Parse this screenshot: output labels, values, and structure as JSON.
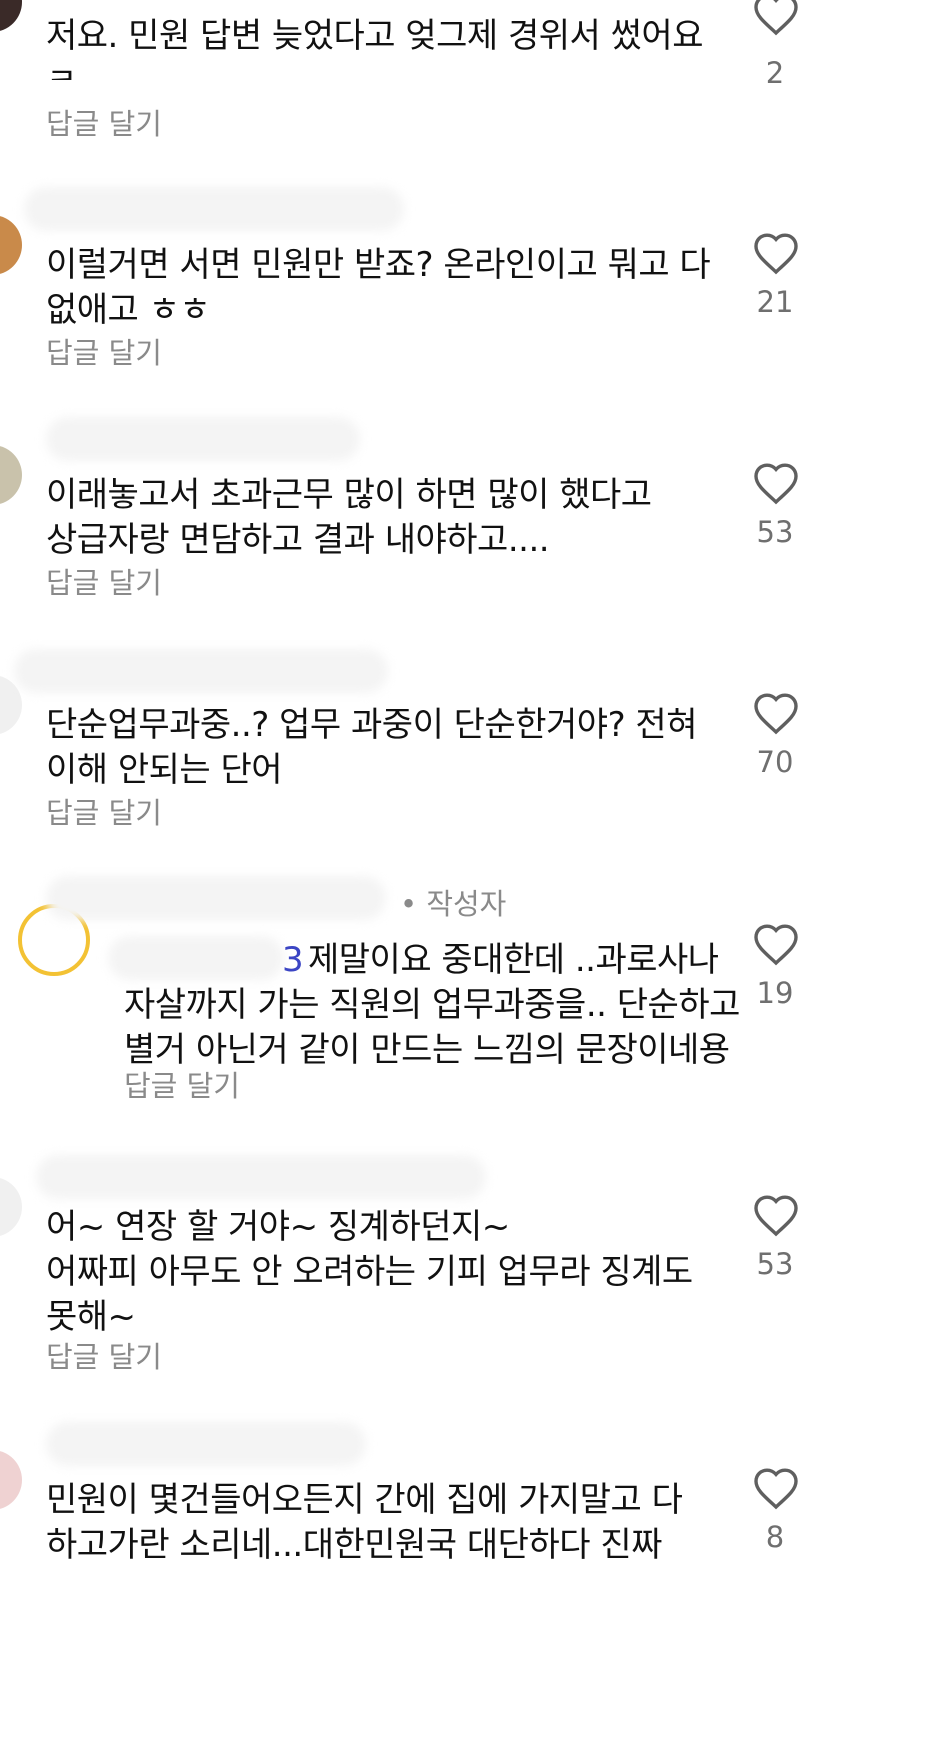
{
  "colors": {
    "text": "#111111",
    "secondary": "#8a8a8a",
    "count": "#6f6f6f",
    "mention": "#3b45c4"
  },
  "icons": {
    "like": "heart-outline-icon"
  },
  "comments": [
    {
      "text": "저요. 민원 답변 늦었다고 엊그제 경위서 썼어요ㅋ\nㅋㅋㅋㅋ",
      "reply_label": "답글 달기",
      "likes": "2"
    },
    {
      "text": "이럴거면 서면 민원만 받죠? 온라인이고 뭐고 다\n없애고 ㅎㅎ",
      "reply_label": "답글 달기",
      "likes": "21"
    },
    {
      "text": "이래놓고서 초과근무 많이 하면 많이 했다고\n상급자랑 면담하고 결과 내야하고....",
      "reply_label": "답글 달기",
      "likes": "53"
    },
    {
      "text": "단순업무과중..? 업무 과중이 단순한거야? 전혀\n이해 안되는 단어",
      "reply_label": "답글 달기",
      "likes": "70"
    },
    {
      "author_tag": "• 작성자",
      "mention": "3",
      "text": "제말이요 중대한데 ..과로사나\n자살까지 가는 직원의 업무과중을.. 단순하고\n별거 아닌거 같이 만드는 느낌의 문장이네용",
      "reply_label": "답글 달기",
      "likes": "19"
    },
    {
      "text": "어~ 연장 할 거야~ 징계하던지~\n어짜피 아무도 안 오려하는 기피 업무라 징계도\n못해~",
      "reply_label": "답글 달기",
      "likes": "53"
    },
    {
      "text": "민원이 몇건들어오든지 간에 집에 가지말고 다\n하고가란 소리네...대한민원국 대단하다 진짜",
      "likes": "8"
    }
  ]
}
